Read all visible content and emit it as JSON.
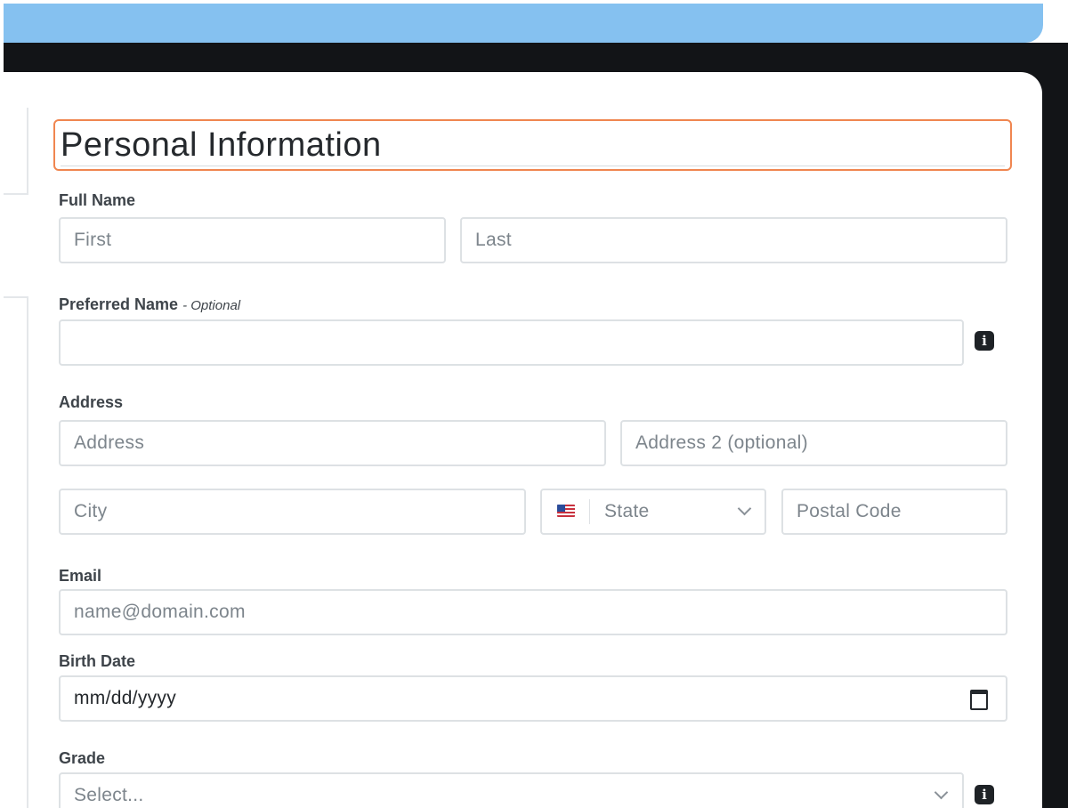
{
  "section": {
    "title": "Personal Information"
  },
  "full_name": {
    "label": "Full Name",
    "first_placeholder": "First",
    "last_placeholder": "Last"
  },
  "preferred_name": {
    "label": "Preferred Name",
    "optional_note": "- Optional",
    "value": ""
  },
  "address": {
    "label": "Address",
    "address_placeholder": "Address",
    "address2_placeholder": "Address 2 (optional)",
    "city_placeholder": "City",
    "state_placeholder": "State",
    "postal_placeholder": "Postal Code"
  },
  "email": {
    "label": "Email",
    "placeholder": "name@domain.com"
  },
  "birth_date": {
    "label": "Birth Date",
    "placeholder": "mm/dd/yyyy"
  },
  "grade": {
    "label": "Grade",
    "placeholder": "Select..."
  },
  "icons": {
    "info": "info-icon",
    "flag": "us-flag-icon",
    "calendar": "calendar-icon",
    "chevron": "chevron-down-icon"
  },
  "colors": {
    "banner": "#85c1f0",
    "focus_border": "#f08650",
    "dark_band": "#121417"
  }
}
